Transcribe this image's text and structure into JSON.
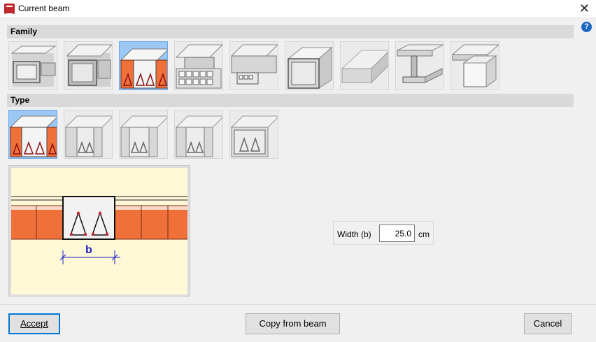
{
  "window": {
    "title": "Current beam",
    "close_glyph": "✕",
    "help_glyph": "?"
  },
  "sections": {
    "family": "Family",
    "type": "Type"
  },
  "family_items": [
    {
      "name": "hollow-box-beam-icon"
    },
    {
      "name": "box-slab-beam-icon"
    },
    {
      "name": "lattice-joist-beam-icon",
      "selected": true
    },
    {
      "name": "waffle-slab-beam-icon"
    },
    {
      "name": "block-slab-beam-icon"
    },
    {
      "name": "concrete-box-beam-icon"
    },
    {
      "name": "flat-slab-beam-icon"
    },
    {
      "name": "steel-i-beam-icon"
    },
    {
      "name": "solid-block-beam-icon"
    }
  ],
  "type_items": [
    {
      "name": "type-hollow-blocks-icon",
      "selected": true
    },
    {
      "name": "type-gray-blocks-icon"
    },
    {
      "name": "type-gray-blocks-2-icon"
    },
    {
      "name": "type-gray-blocks-3-icon"
    },
    {
      "name": "type-gray-single-icon"
    }
  ],
  "preview": {
    "dimension_label": "b"
  },
  "width_param": {
    "label": "Width (b)",
    "value": "25.0",
    "unit": "cm"
  },
  "buttons": {
    "accept": "Accept",
    "copy": "Copy from beam",
    "cancel": "Cancel"
  },
  "colors": {
    "accent": "#0078d7",
    "brick": "#f0703a",
    "rebar": "#c0282d",
    "dim": "#1a20c8"
  }
}
